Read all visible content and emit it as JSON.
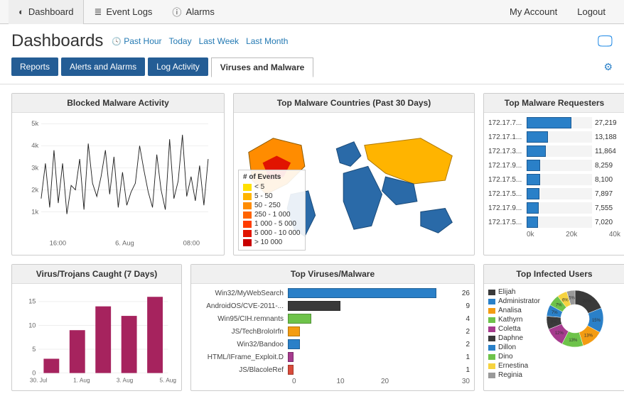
{
  "topnav": {
    "dashboard": "Dashboard",
    "eventlogs": "Event Logs",
    "alarms": "Alarms",
    "account": "My Account",
    "logout": "Logout"
  },
  "page_title": "Dashboards",
  "time_links": [
    "Past Hour",
    "Today",
    "Last Week",
    "Last Month"
  ],
  "tabs": {
    "reports": "Reports",
    "alerts": "Alerts and Alarms",
    "logactivity": "Log Activity",
    "active": "Viruses and Malware"
  },
  "cards": {
    "blocked_title": "Blocked Malware Activity",
    "map_title": "Top Malware Countries (Past 30 Days)",
    "requesters_title": "Top Malware Requesters",
    "trojans_title": "Virus/Trojans Caught (7 Days)",
    "topviruses_title": "Top Viruses/Malware",
    "infected_title": "Top Infected Users"
  },
  "map_legend": {
    "title": "# of Events",
    "bins": [
      {
        "label": "< 5",
        "color": "#ffe000"
      },
      {
        "label": "5 - 50",
        "color": "#ffb400"
      },
      {
        "label": "50 - 250",
        "color": "#ff8c00"
      },
      {
        "label": "250 - 1 000",
        "color": "#ff6400"
      },
      {
        "label": "1 000 - 5 000",
        "color": "#ff3c00"
      },
      {
        "label": "5 000 - 10 000",
        "color": "#e11400"
      },
      {
        "label": "> 10 000",
        "color": "#c80000"
      }
    ]
  },
  "requesters": {
    "max": 40000,
    "axis": [
      "0k",
      "20k",
      "40k"
    ],
    "rows": [
      {
        "label": "172.17.7...",
        "value": 27219
      },
      {
        "label": "172.17.1...",
        "value": 13188
      },
      {
        "label": "172.17.3...",
        "value": 11864
      },
      {
        "label": "172.17.9...",
        "value": 8259
      },
      {
        "label": "172.17.5...",
        "value": 8100
      },
      {
        "label": "172.17.5...",
        "value": 7897
      },
      {
        "label": "172.17.9...",
        "value": 7555
      },
      {
        "label": "172.17.5...",
        "value": 7020
      }
    ]
  },
  "top_viruses": {
    "max": 30,
    "axis": [
      "0",
      "10",
      "20",
      "30"
    ],
    "rows": [
      {
        "label": "Win32/MyWebSearch",
        "value": 26,
        "color": "#2a80c8"
      },
      {
        "label": "AndroidOS/CVE-2011-...",
        "value": 9,
        "color": "#3a3a3a"
      },
      {
        "label": "Win95/CIH.remnants",
        "value": 4,
        "color": "#6ec34a"
      },
      {
        "label": "JS/TechBroloIrfn",
        "value": 2,
        "color": "#f39c12"
      },
      {
        "label": "Win32/Bandoo",
        "value": 2,
        "color": "#2a80c8"
      },
      {
        "label": "HTML/IFrame_Exploit.D",
        "value": 1,
        "color": "#a63b8e"
      },
      {
        "label": "JS/BlacoleRef",
        "value": 1,
        "color": "#d94b3b"
      }
    ]
  },
  "infected_users": {
    "legend": [
      {
        "name": "Elijah",
        "color": "#3a3a3a"
      },
      {
        "name": "Administrator",
        "color": "#2a80c8"
      },
      {
        "name": "Analisa",
        "color": "#f39c12"
      },
      {
        "name": "Kathyrn",
        "color": "#6ec34a"
      },
      {
        "name": "Coletta",
        "color": "#a63b8e"
      },
      {
        "name": "Daphne",
        "color": "#3a3a3a"
      },
      {
        "name": "Dillon",
        "color": "#2a80c8"
      },
      {
        "name": "Dino",
        "color": "#6ec34a"
      },
      {
        "name": "Ernestina",
        "color": "#f6d340"
      },
      {
        "name": "Reginia",
        "color": "#999999"
      }
    ],
    "slices": [
      20,
      15,
      13,
      13,
      12,
      8,
      7,
      7,
      6,
      5
    ]
  },
  "chart_data": [
    {
      "type": "line",
      "title": "Blocked Malware Activity",
      "ylabel": "",
      "xlabel": "",
      "ylim": [
        0,
        5000
      ],
      "y_ticks": [
        "1k",
        "2k",
        "3k",
        "4k",
        "5k"
      ],
      "x_ticks": [
        "16:00",
        "6. Aug",
        "08:00"
      ],
      "series": [
        {
          "name": "events",
          "values": [
            1600,
            3200,
            1200,
            3800,
            1400,
            3200,
            900,
            2200,
            2000,
            3400,
            1100,
            4100,
            2300,
            1700,
            2600,
            3800,
            1800,
            3500,
            1200,
            2800,
            1300,
            1900,
            2300,
            4000,
            2900,
            1900,
            1200,
            3600,
            2000,
            1100,
            4300,
            1600,
            2400,
            4500,
            1700,
            2600,
            1500,
            3100,
            1300,
            3400
          ]
        }
      ]
    },
    {
      "type": "bar",
      "title": "Virus/Trojans Caught (7 Days)",
      "categories": [
        "30. Jul",
        "1. Aug",
        "3. Aug",
        "5. Aug"
      ],
      "ylim": [
        0,
        17
      ],
      "y_ticks": [
        0,
        5,
        10,
        15
      ],
      "values": [
        3,
        9,
        14,
        12,
        16
      ]
    },
    {
      "type": "bar",
      "title": "Top Malware Requesters",
      "orientation": "horizontal",
      "categories": [
        "172.17.7...",
        "172.17.1...",
        "172.17.3...",
        "172.17.9...",
        "172.17.5...",
        "172.17.5...",
        "172.17.9...",
        "172.17.5..."
      ],
      "values": [
        27219,
        13188,
        11864,
        8259,
        8100,
        7897,
        7555,
        7020
      ],
      "xlim": [
        0,
        40000
      ]
    },
    {
      "type": "bar",
      "title": "Top Viruses/Malware",
      "orientation": "horizontal",
      "categories": [
        "Win32/MyWebSearch",
        "AndroidOS/CVE-2011-...",
        "Win95/CIH.remnants",
        "JS/TechBroloIrfn",
        "Win32/Bandoo",
        "HTML/IFrame_Exploit.D",
        "JS/BlacoleRef"
      ],
      "values": [
        26,
        9,
        4,
        2,
        2,
        1,
        1
      ],
      "xlim": [
        0,
        30
      ]
    },
    {
      "type": "pie",
      "title": "Top Infected Users",
      "categories": [
        "Elijah",
        "Administrator",
        "Analisa",
        "Kathyrn",
        "Coletta",
        "Daphne",
        "Dillon",
        "Dino",
        "Ernestina",
        "Reginia"
      ],
      "values": [
        20,
        15,
        13,
        13,
        12,
        8,
        7,
        7,
        6,
        5
      ]
    }
  ]
}
